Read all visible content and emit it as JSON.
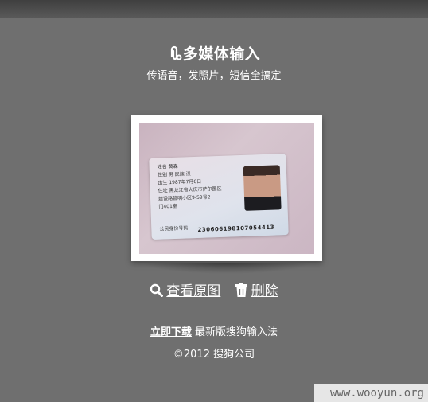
{
  "header": {
    "title": "多媒体输入",
    "subtitle": "传语音，发照片，短信全搞定"
  },
  "photo": {
    "id_lines": [
      "姓名 黄森",
      "性别 男  民族 汉",
      "出生 1987年7月6日",
      "住址 黑龙江省大庆市萨尔图区",
      "建设路管明小区9-59号2",
      "门401室"
    ],
    "id_number_label": "公民身份号码",
    "id_number": "230606198107054413"
  },
  "actions": {
    "view_label": "查看原图",
    "delete_label": "删除"
  },
  "footer": {
    "download_link": "立即下载",
    "download_text": "最新版搜狗输入法",
    "copyright": "©2012 搜狗公司"
  },
  "watermark": "www.wooyun.org",
  "colors": {
    "background": "#6f6f6f",
    "text": "#ffffff"
  }
}
